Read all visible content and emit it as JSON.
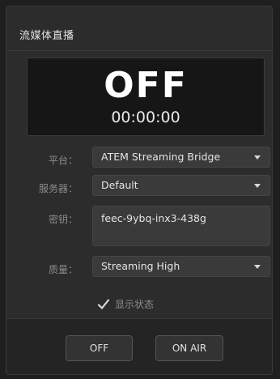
{
  "window": {
    "title": "流媒体直播"
  },
  "status": {
    "state": "OFF",
    "timer": "00:00:00"
  },
  "platform": {
    "label": "平台：",
    "value": "ATEM Streaming Bridge"
  },
  "server": {
    "label": "服务器：",
    "value": "Default"
  },
  "key": {
    "label": "密钥：",
    "value": "feec-9ybq-inx3-438g"
  },
  "quality": {
    "label": "质量：",
    "value": "Streaming High"
  },
  "show_status": {
    "label": "显示状态",
    "checked": true
  },
  "buttons": {
    "off_label": "OFF",
    "on_air_label": "ON AIR"
  },
  "icons": {
    "dropdown": "chevron-down-icon",
    "check": "checkmark-icon"
  }
}
